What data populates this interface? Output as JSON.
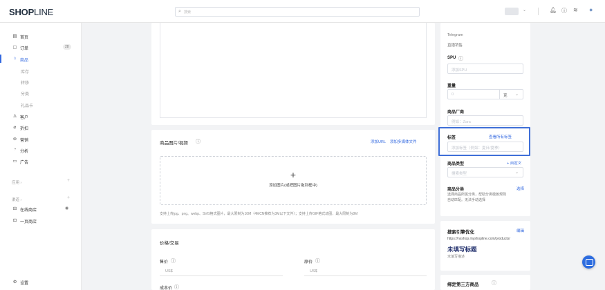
{
  "header": {
    "logo": "SHOPLINE",
    "search_placeholder": "搜索",
    "icons": [
      "chevron-down-icon",
      "bell-icon",
      "help-icon",
      "wifi-icon",
      "user-icon"
    ]
  },
  "sidebar": {
    "items": [
      {
        "label": "首页",
        "icon": "home-icon"
      },
      {
        "label": "订单",
        "icon": "order-icon",
        "badge": "28"
      },
      {
        "label": "商品",
        "icon": "product-icon",
        "active": true
      },
      {
        "label": "库存",
        "sub": true
      },
      {
        "label": "转移",
        "sub": true
      },
      {
        "label": "分类",
        "sub": true
      },
      {
        "label": "礼品卡",
        "sub": true
      },
      {
        "label": "客户",
        "icon": "customer-icon"
      },
      {
        "label": "折扣",
        "icon": "discount-icon"
      },
      {
        "label": "营销",
        "icon": "marketing-icon"
      },
      {
        "label": "分析",
        "icon": "analytics-icon"
      },
      {
        "label": "广告",
        "icon": "ads-icon"
      }
    ],
    "apps_label": "应用 ›",
    "channels_label": "渠道 ›",
    "channels": [
      {
        "label": "在线商店",
        "icon": "store-icon"
      },
      {
        "label": "一页商店",
        "icon": "one-page-icon"
      }
    ],
    "settings_label": "设置"
  },
  "media": {
    "title": "商品图片/视频",
    "add_url": "添加URL",
    "add_multiple": "添加多媒体文件",
    "dropzone_text": "添加图片(或把图片拖到框中)",
    "hint": "支持上传jpg、png、webp、SVG格式图片，最大限制为10M（4MCN推荐为3M以下文件）；支持上传GIF格式动图，最大限制为8M"
  },
  "pricing": {
    "title": "价格/交易",
    "price_label": "售价",
    "compare_label": "原价",
    "currency": "US$",
    "cost_label": "成本价"
  },
  "right": {
    "channels": [
      "Telegram",
      "直播销售"
    ],
    "spu_label": "SPU",
    "spu_placeholder": "添加SPU",
    "weight_label": "重量",
    "weight_value": "0",
    "weight_unit": "克",
    "vendor_label": "商品厂商",
    "vendor_placeholder": "例如：Zara",
    "tags_label": "标签",
    "tags_link": "查看所有标签",
    "tags_placeholder": "添加标签（例如：夏日/夏季）",
    "type_label": "商品类型",
    "type_link": "+ 自定义",
    "type_placeholder": "搜索类型",
    "category_label": "商品分类",
    "category_link": "选择",
    "category_desc_1": "选择商品所属分类，帮助分类模板规则",
    "category_desc_2": "自动匹配。无法手动选择",
    "seo_title": "搜索引擎优化",
    "seo_link": "编辑",
    "seo_url": "https://nxshop.myshopline.com/products/",
    "seo_heading": "未填写标题",
    "seo_desc": "未填写描述",
    "third_party_label": "绑定第三方商品"
  }
}
